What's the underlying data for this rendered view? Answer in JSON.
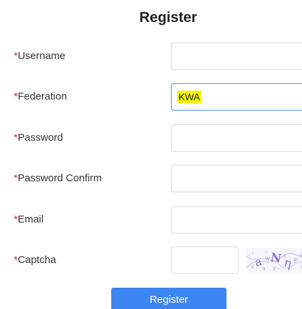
{
  "form": {
    "title": "Register",
    "required_mark": "*",
    "fields": {
      "username": {
        "label": "Username",
        "value": ""
      },
      "federation": {
        "label": "Federation",
        "value": "KWA",
        "highlight": "#f5f500"
      },
      "password": {
        "label": "Password",
        "value": ""
      },
      "password_confirm": {
        "label": "Password Confirm",
        "value": ""
      },
      "email": {
        "label": "Email",
        "value": ""
      },
      "captcha": {
        "label": "Captcha",
        "value": ""
      }
    },
    "submit_label": "Register"
  },
  "colors": {
    "accent": "#3d85f2",
    "required": "#e02020",
    "focus_border": "#4a8cf0"
  }
}
